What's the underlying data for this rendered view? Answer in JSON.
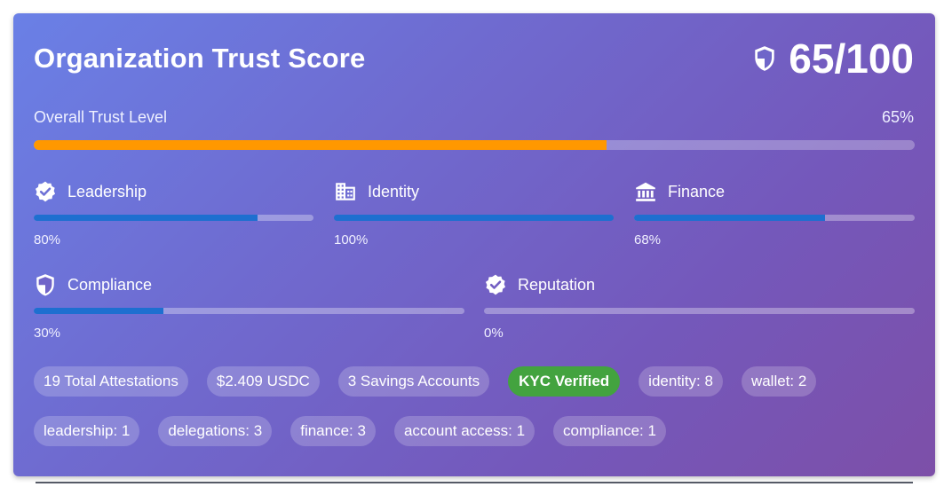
{
  "header": {
    "title": "Organization Trust Score",
    "score": "65/100",
    "score_icon": "shield-half-icon"
  },
  "overall": {
    "label": "Overall Trust Level",
    "percent_text": "65%",
    "value": 65,
    "color": "#ff9800"
  },
  "metrics": [
    {
      "label": "Leadership",
      "percent_text": "80%",
      "value": 80,
      "icon": "verified-badge-icon"
    },
    {
      "label": "Identity",
      "percent_text": "100%",
      "value": 100,
      "icon": "building-icon"
    },
    {
      "label": "Finance",
      "percent_text": "68%",
      "value": 68,
      "icon": "bank-icon"
    },
    {
      "label": "Compliance",
      "percent_text": "30%",
      "value": 30,
      "icon": "shield-half-icon"
    },
    {
      "label": "Reputation",
      "percent_text": "0%",
      "value": 0,
      "icon": "verified-badge-icon"
    }
  ],
  "bar_color": "#1e6fd0",
  "chips_row1": [
    {
      "label": "19 Total Attestations"
    },
    {
      "label": "$2.409 USDC"
    },
    {
      "label": "3 Savings Accounts"
    },
    {
      "label": "KYC Verified",
      "highlight": true,
      "color": "#43a33f"
    },
    {
      "label": "identity: 8"
    },
    {
      "label": "wallet: 2"
    }
  ],
  "chips_row2": [
    {
      "label": "leadership: 1"
    },
    {
      "label": "delegations: 3"
    },
    {
      "label": "finance: 3"
    },
    {
      "label": "account access: 1"
    },
    {
      "label": "compliance: 1"
    }
  ]
}
